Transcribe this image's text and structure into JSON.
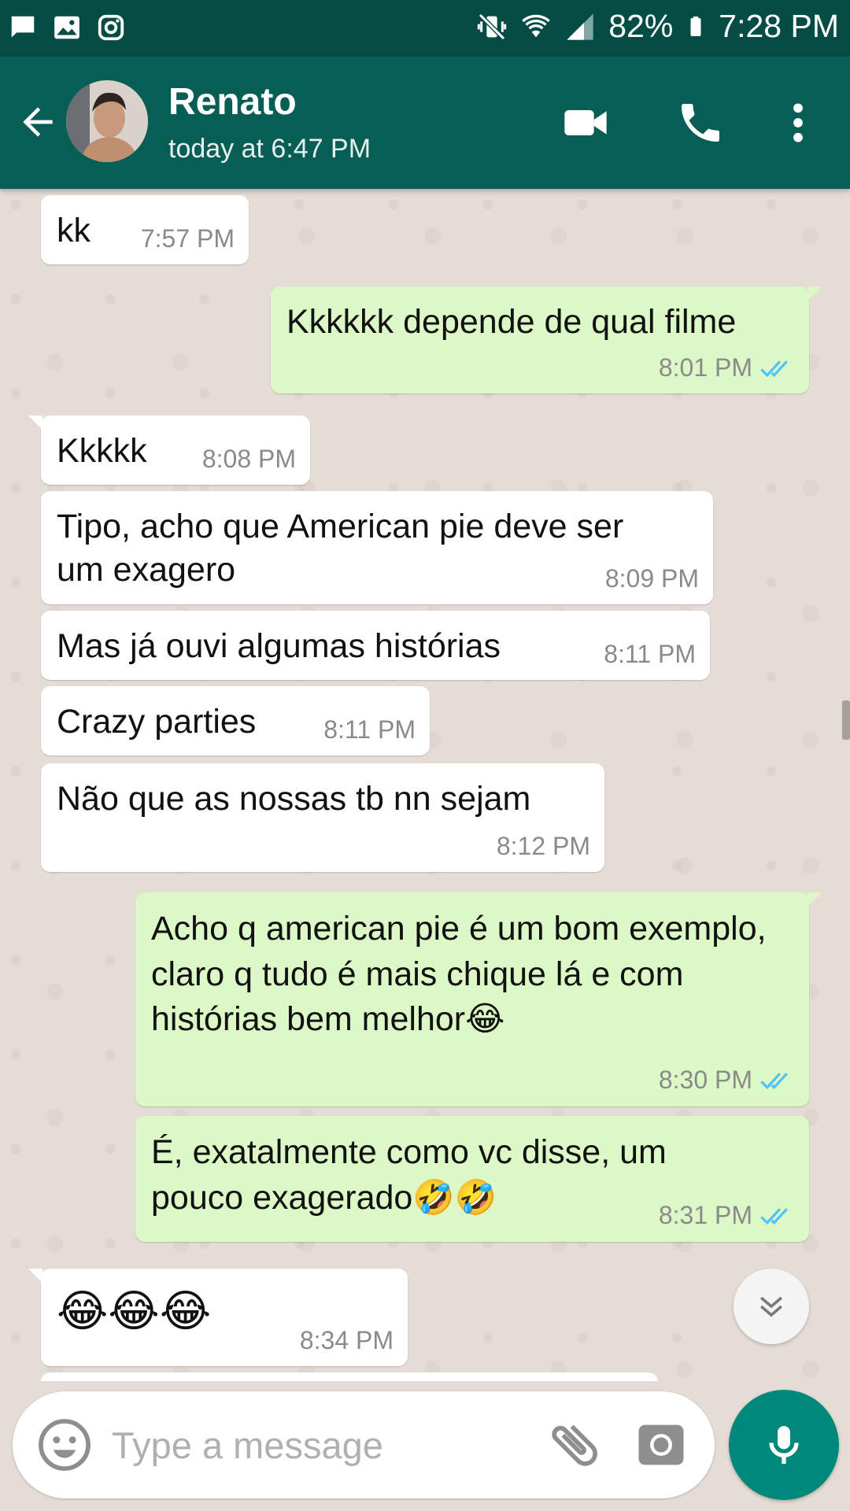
{
  "status_bar": {
    "battery": "82%",
    "time": "7:28 PM",
    "icons": [
      "message-icon",
      "image-icon",
      "instagram-icon",
      "mute-vibrate-icon",
      "wifi-icon",
      "signal-icon",
      "battery-icon"
    ]
  },
  "header": {
    "name": "Renato",
    "last_seen": "today at 6:47 PM",
    "icons": [
      "back-arrow-icon",
      "video-call-icon",
      "phone-icon",
      "more-vert-icon"
    ]
  },
  "messages": [
    {
      "dir": "in",
      "text": "kk",
      "time": "7:57 PM"
    },
    {
      "dir": "out",
      "text": "Kkkkkk depende de qual filme",
      "time": "8:01 PM",
      "read": true
    },
    {
      "dir": "in",
      "text": "Kkkkk",
      "time": "8:08 PM"
    },
    {
      "dir": "in",
      "text": "Tipo, acho que American pie deve ser um exagero",
      "time": "8:09 PM"
    },
    {
      "dir": "in",
      "text": "Mas já ouvi algumas histórias",
      "time": "8:11 PM"
    },
    {
      "dir": "in",
      "text": "Crazy parties",
      "time": "8:11 PM"
    },
    {
      "dir": "in",
      "text": "Não que as nossas tb nn sejam",
      "time": "8:12 PM"
    },
    {
      "dir": "out",
      "text": "Acho q american pie é um bom exemplo, claro q tudo é mais chique lá e com histórias bem melhor",
      "emoji": "😂",
      "time": "8:30 PM",
      "read": true
    },
    {
      "dir": "out",
      "text": "É, exatalmente como vc disse, um pouco exagerado",
      "emoji": "🤣🤣",
      "time": "8:31 PM",
      "read": true
    },
    {
      "dir": "in",
      "text": "😂😂😂",
      "time": "8:34 PM"
    }
  ],
  "input": {
    "placeholder": "Type a message",
    "icons": [
      "emoji-icon",
      "attach-icon",
      "camera-icon",
      "mic-icon"
    ]
  },
  "colors": {
    "status_bar": "#054d44",
    "header": "#075e54",
    "outgoing_bubble": "#dcf8c6",
    "incoming_bubble": "#ffffff",
    "chat_background": "#e5ddd5",
    "read_ticks": "#4fc3f7",
    "mic_button": "#00897b"
  }
}
